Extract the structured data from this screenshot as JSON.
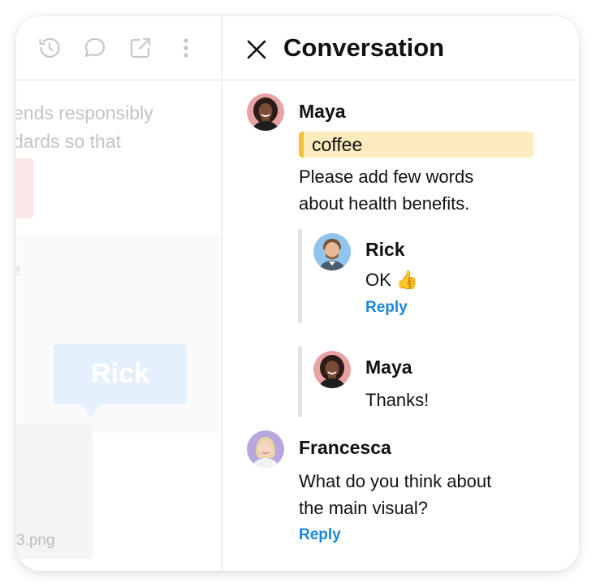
{
  "left_pane": {
    "toolbar_icons": [
      "history-icon",
      "comment-icon",
      "external-link-icon",
      "more-vertical-icon"
    ],
    "ghost_text_line1": "ends responsibly",
    "ghost_text_line2": "dards so that",
    "ghost_letter": "e",
    "ghost_tag_label": "Rick",
    "ghost_filename": "3.png"
  },
  "panel": {
    "title": "Conversation",
    "close_icon": "close-icon"
  },
  "thread": {
    "maya": {
      "name": "Maya",
      "highlight": "coffee",
      "message_line1": "Please add few words",
      "message_line2": "about health benefits."
    },
    "rick": {
      "name": "Rick",
      "message": "OK 👍",
      "reply_label": "Reply"
    },
    "maya_reply": {
      "name": "Maya",
      "message": "Thanks!"
    },
    "francesca": {
      "name": "Francesca",
      "message_line1": "What do you think about",
      "message_line2": "the main visual?",
      "reply_label": "Reply"
    }
  },
  "colors": {
    "reply_link": "#1a86d9",
    "highlight_bg": "#fcebbd",
    "highlight_border": "#f0c232"
  }
}
